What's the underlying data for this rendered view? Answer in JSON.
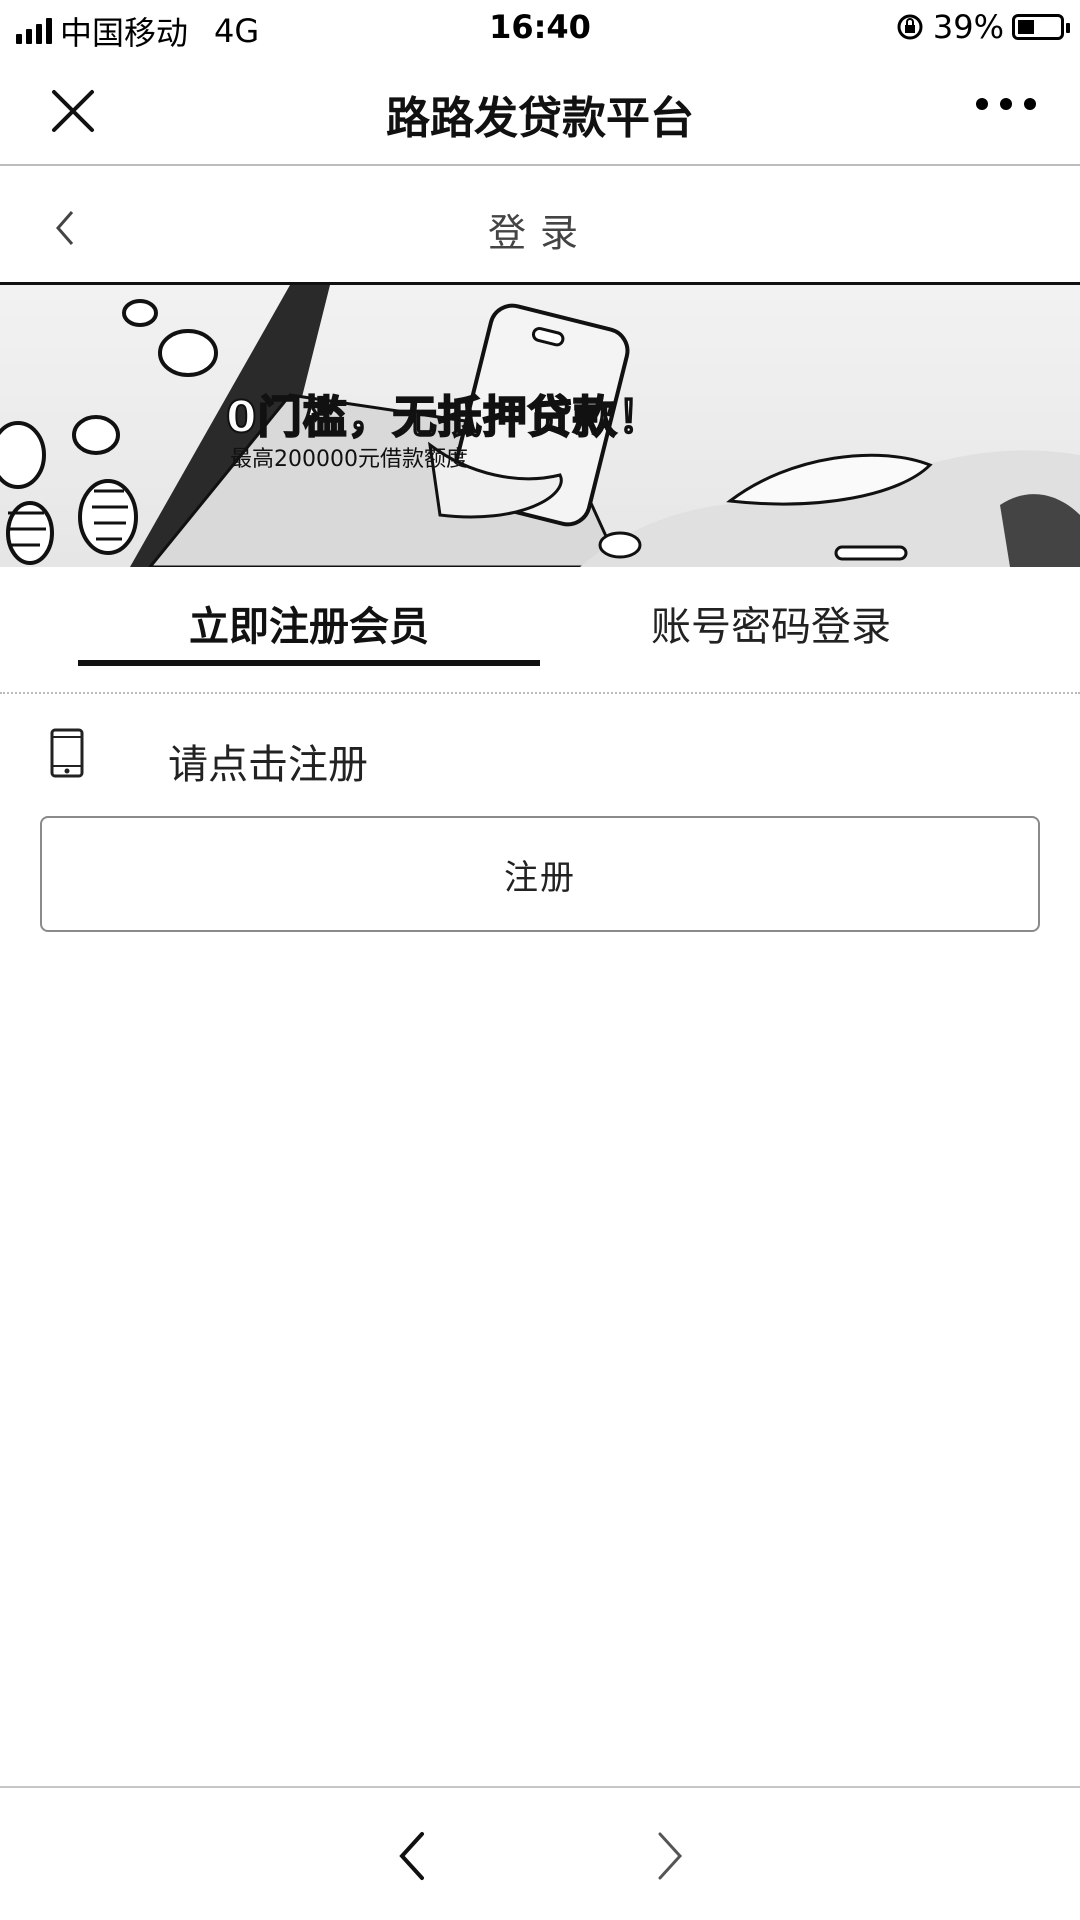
{
  "status_bar": {
    "carrier": "中国移动",
    "network": "4G",
    "time": "16:40",
    "battery_percent": "39%",
    "battery_level": 0.39
  },
  "nav": {
    "title": "路路发贷款平台",
    "close_icon": "close-icon",
    "more_icon": "more-icon"
  },
  "page": {
    "title": "登录",
    "back_icon": "chevron-left-icon"
  },
  "banner": {
    "headline": "0门槛，无抵押贷款！",
    "subline": "最高200000元借款额度"
  },
  "tabs": [
    {
      "label": "立即注册会员",
      "active": true
    },
    {
      "label": "账号密码登录",
      "active": false
    }
  ],
  "form": {
    "phone_icon": "mobile-phone-icon",
    "phone_label": "请点击注册",
    "register_button": "注册"
  },
  "toolbar": {
    "back_icon": "chevron-left-icon",
    "forward_icon": "chevron-right-icon"
  },
  "colors": {
    "text": "#111111",
    "divider": "#bdbdbd",
    "button_border": "#8a8a8a"
  }
}
